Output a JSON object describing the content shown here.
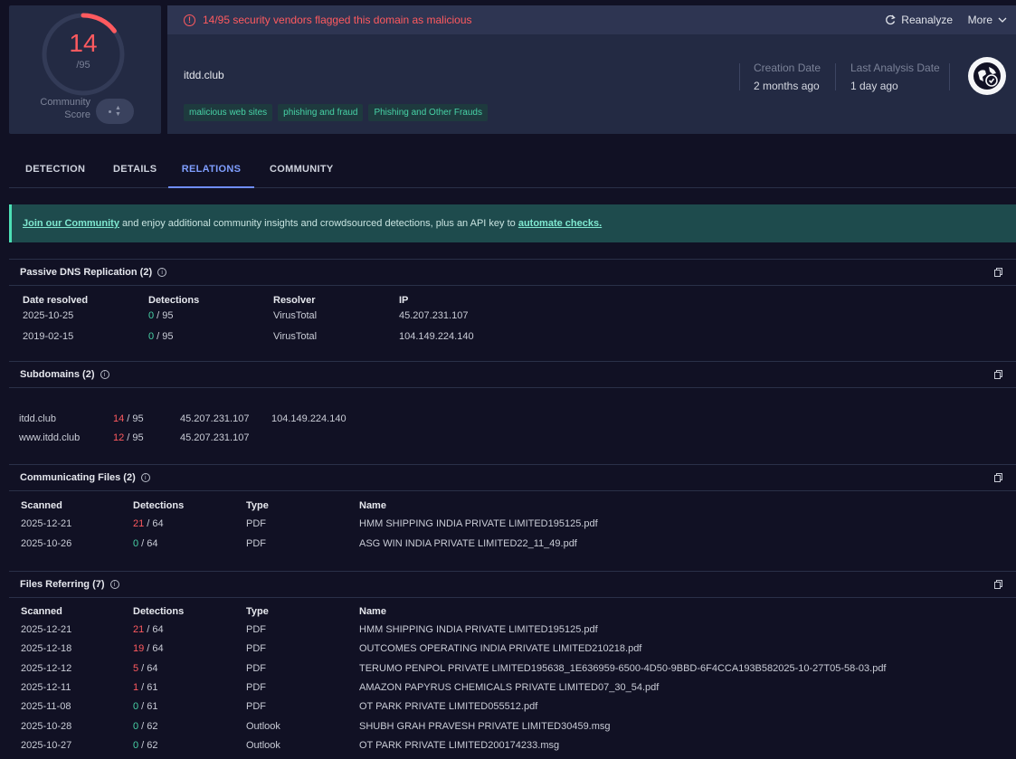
{
  "score": {
    "positives": "14",
    "total": "/95",
    "community_label_1": "Community",
    "community_label_2": "Score"
  },
  "alert": {
    "text": "14/95 security vendors flagged this domain as malicious"
  },
  "toolbar": {
    "reanalyze": "Reanalyze",
    "more": "More"
  },
  "domain": "itdd.club",
  "tags": [
    "malicious web sites",
    "phishing and fraud",
    "Phishing and Other Frauds"
  ],
  "meta": {
    "creation_label": "Creation Date",
    "creation_value": "2 months ago",
    "analysis_label": "Last Analysis Date",
    "analysis_value": "1 day ago"
  },
  "tabs": [
    "DETECTION",
    "DETAILS",
    "RELATIONS",
    "COMMUNITY"
  ],
  "active_tab": "RELATIONS",
  "banner": {
    "link1": "Join our Community",
    "text": " and enjoy additional community insights and crowdsourced detections, plus an API key to ",
    "link2": "automate checks."
  },
  "passive_dns": {
    "title": "Passive DNS Replication (2)",
    "headers": [
      "Date resolved",
      "Detections",
      "Resolver",
      "IP"
    ],
    "rows": [
      {
        "date": "2025-10-25",
        "det": "0",
        "tot": " / 95",
        "resolver": "VirusTotal",
        "ip": "45.207.231.107"
      },
      {
        "date": "2019-02-15",
        "det": "0",
        "tot": " / 95",
        "resolver": "VirusTotal",
        "ip": "104.149.224.140"
      }
    ]
  },
  "subdomains": {
    "title": "Subdomains (2)",
    "rows": [
      {
        "name": "itdd.club",
        "det": "14",
        "tot": " / 95",
        "ip1": "45.207.231.107",
        "ip2": "104.149.224.140"
      },
      {
        "name": "www.itdd.club",
        "det": "12",
        "tot": " / 95",
        "ip1": "45.207.231.107",
        "ip2": ""
      }
    ]
  },
  "communicating": {
    "title": "Communicating Files (2)",
    "headers": [
      "Scanned",
      "Detections",
      "Type",
      "Name"
    ],
    "rows": [
      {
        "date": "2025-12-21",
        "det": "21",
        "tot": " / 64",
        "type": "PDF",
        "name": "HMM SHIPPING INDIA PRIVATE LIMITED195125.pdf"
      },
      {
        "date": "2025-10-26",
        "det": "0",
        "tot": " / 64",
        "type": "PDF",
        "name": "ASG WIN INDIA PRIVATE LIMITED22_11_49.pdf"
      }
    ]
  },
  "referring": {
    "title": "Files Referring (7)",
    "headers": [
      "Scanned",
      "Detections",
      "Type",
      "Name"
    ],
    "rows": [
      {
        "date": "2025-12-21",
        "det": "21",
        "tot": " / 64",
        "type": "PDF",
        "name": "HMM SHIPPING INDIA PRIVATE LIMITED195125.pdf"
      },
      {
        "date": "2025-12-18",
        "det": "19",
        "tot": " / 64",
        "type": "PDF",
        "name": "OUTCOMES OPERATING INDIA PRIVATE LIMITED210218.pdf"
      },
      {
        "date": "2025-12-12",
        "det": "5",
        "tot": " / 64",
        "type": "PDF",
        "name": "TERUMO PENPOL PRIVATE LIMITED195638_1E636959-6500-4D50-9BBD-6F4CCA193B582025-10-27T05-58-03.pdf"
      },
      {
        "date": "2025-12-11",
        "det": "1",
        "tot": " / 61",
        "type": "PDF",
        "name": "AMAZON PAPYRUS CHEMICALS PRIVATE LIMITED07_30_54.pdf"
      },
      {
        "date": "2025-11-08",
        "det": "0",
        "tot": " / 61",
        "type": "PDF",
        "name": "OT PARK PRIVATE LIMITED055512.pdf"
      },
      {
        "date": "2025-10-28",
        "det": "0",
        "tot": " / 62",
        "type": "Outlook",
        "name": "SHUBH GRAH PRAVESH PRIVATE LIMITED30459.msg"
      },
      {
        "date": "2025-10-27",
        "det": "0",
        "tot": " / 62",
        "type": "Outlook",
        "name": "OT PARK PRIVATE LIMITED200174233.msg"
      }
    ]
  },
  "colors": {
    "bad": "#ff5a5f",
    "good": "#47d2a6",
    "accent": "#6f8dff",
    "tag": "#47d2a6"
  }
}
